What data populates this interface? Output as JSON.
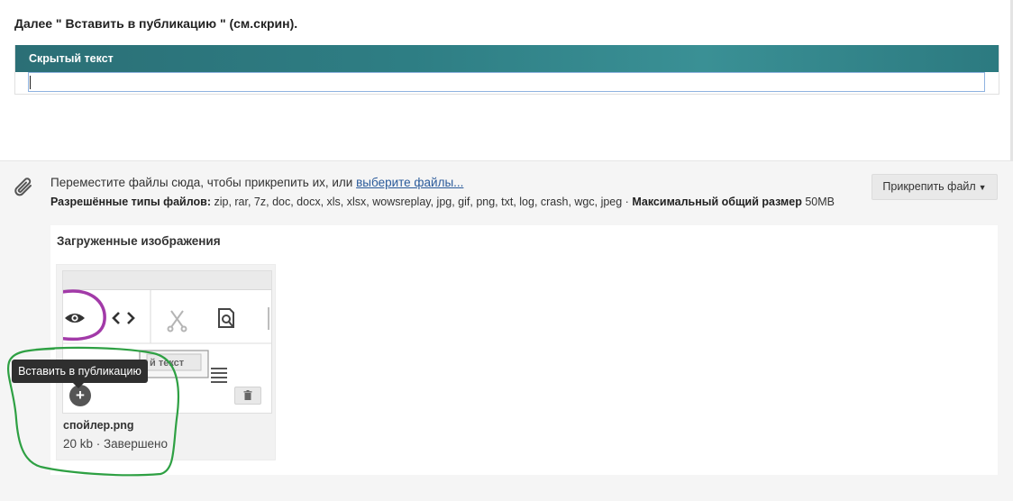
{
  "intro": {
    "text": "Далее  \" Вставить в публикацию \" (см.скрин)."
  },
  "spoiler": {
    "header": "Скрытый текст",
    "body_value": ""
  },
  "attachments": {
    "drop_text": "Переместите файлы сюда, чтобы прикрепить их, или ",
    "choose_link": "выберите файлы...",
    "types_label": "Разрешённые типы файлов:",
    "types_value": " zip, rar, 7z, doc, docx, xls, xlsx, wowsreplay, jpg, gif, png, txt, log, crash, wgc, jpeg · ",
    "max_size_label": "Максимальный общий размер",
    "max_size_value": " 50MB",
    "attach_button": "Прикрепить файл",
    "uploaded_title": "Загруженные изображения",
    "files": [
      {
        "name": "спойлер.png",
        "meta": "20 kb · Завершено"
      }
    ],
    "thumb_fragment_text": "й текст"
  },
  "tooltip": {
    "text": "Вставить в публикацию"
  },
  "icons": {
    "attach": "paperclip-icon",
    "add": "plus-circle-icon",
    "delete": "trash-icon",
    "dropdown": "caret-down-icon"
  },
  "colors": {
    "spoiler_header": "#2e7e84",
    "link": "#2a5a9a",
    "annotation": "#2ea043",
    "thumb_highlight": "#a23aa8",
    "tooltip_bg": "#2f2f2f"
  }
}
